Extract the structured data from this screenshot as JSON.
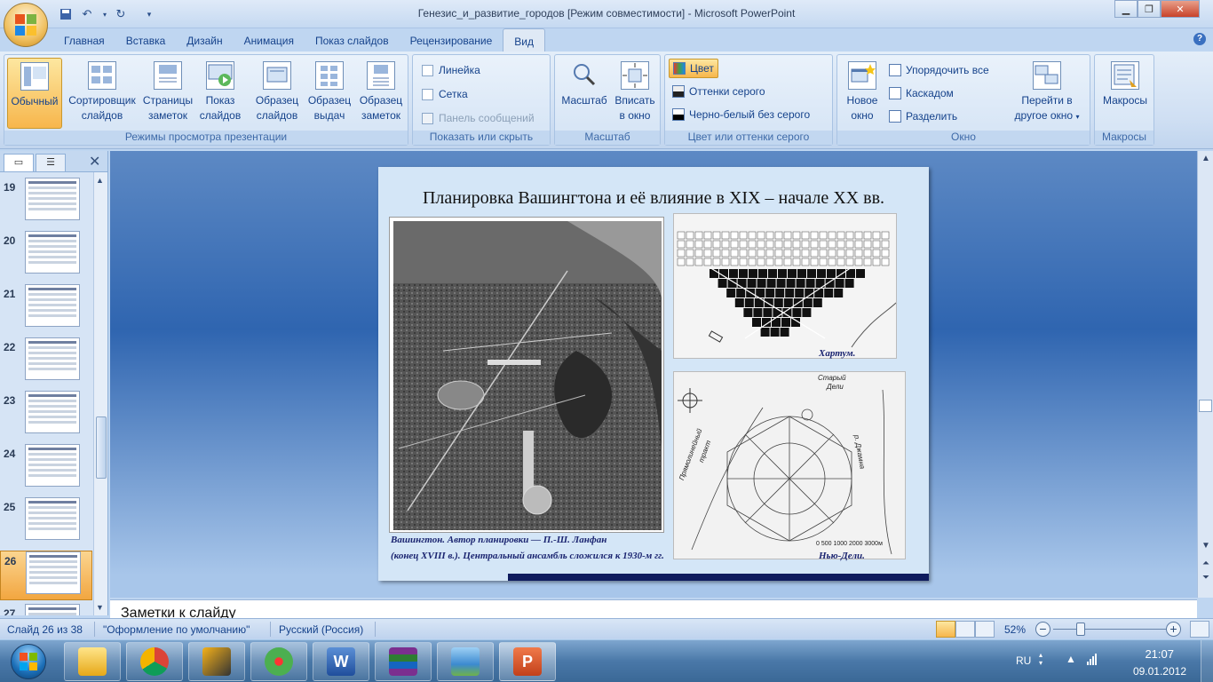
{
  "window": {
    "title": "Генезис_и_развитие_городов [Режим совместимости] - Microsoft PowerPoint"
  },
  "tabs": [
    "Главная",
    "Вставка",
    "Дизайн",
    "Анимация",
    "Показ слайдов",
    "Рецензирование",
    "Вид"
  ],
  "active_tab": "Вид",
  "ribbon": {
    "views": {
      "label": "Режимы просмотра презентации",
      "normal": "Обычный",
      "sorter_1": "Сортировщик",
      "sorter_2": "слайдов",
      "notes_1": "Страницы",
      "notes_2": "заметок",
      "show_1": "Показ",
      "show_2": "слайдов",
      "smaster_1": "Образец",
      "smaster_2": "слайдов",
      "hmaster_1": "Образец",
      "hmaster_2": "выдач",
      "nmaster_1": "Образец",
      "nmaster_2": "заметок"
    },
    "showhide": {
      "label": "Показать или скрыть",
      "ruler": "Линейка",
      "grid": "Сетка",
      "msgbar": "Панель сообщений"
    },
    "zoom": {
      "label": "Масштаб",
      "zoom": "Масштаб",
      "fit_1": "Вписать",
      "fit_2": "в окно"
    },
    "color": {
      "label": "Цвет или оттенки серого",
      "color": "Цвет",
      "grayscale": "Оттенки серого",
      "bw": "Черно-белый без серого"
    },
    "window": {
      "label": "Окно",
      "new_1": "Новое",
      "new_2": "окно",
      "arrange": "Упорядочить все",
      "cascade": "Каскадом",
      "split": "Разделить",
      "switch_1": "Перейти в",
      "switch_2": "другое окно"
    },
    "macros": {
      "label": "Макросы",
      "macros": "Макросы"
    }
  },
  "thumbnails": [
    "19",
    "20",
    "21",
    "22",
    "23",
    "24",
    "25",
    "26",
    "27"
  ],
  "active_slide": "26",
  "slide": {
    "title": "Планировка Вашингтона и её влияние в XIX – начале XX вв.",
    "caption_washington_1": "Вашингтон. Автор планировки — П.-Ш. Ланфан",
    "caption_washington_2": "(конец XVIII в.). Центральный ансамбль сложился к 1930-м гг.",
    "caption_khartoum": "Хартум.",
    "caption_delhi": "Нью-Дели.",
    "delhi_label_old": "Старый",
    "delhi_label_delhi": "Дели",
    "delhi_label_jamna": "р. Джамна",
    "delhi_label_road_1": "Прямолинейный",
    "delhi_label_road_2": "тракт",
    "delhi_scale": "0   500  1000    2000    3000м"
  },
  "notes": {
    "text": "Заметки к слайду"
  },
  "status": {
    "slide": "Слайд 26 из 38",
    "theme": "\"Оформление по умолчанию\"",
    "language": "Русский (Россия)",
    "zoom": "52%"
  },
  "taskbar": {
    "lang": "RU",
    "time": "21:07",
    "date": "09.01.2012"
  },
  "colors": {
    "accent": "#15428b",
    "ribbon_bg": "#dfe9f5",
    "slide_bg": "#d4e6f7",
    "caption": "#1a2470",
    "active_orange": "#f7b64c"
  }
}
